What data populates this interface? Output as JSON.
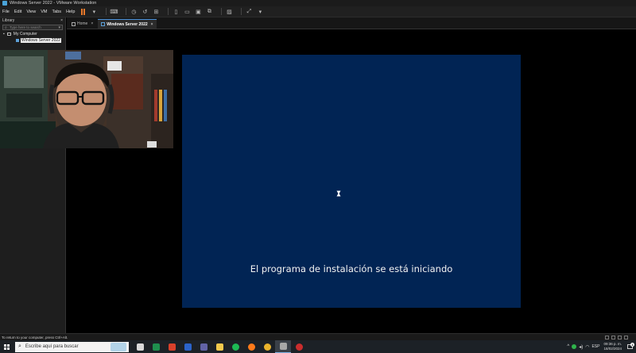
{
  "window": {
    "title": "Windows Server 2022 - VMware Workstation"
  },
  "menu": [
    "File",
    "Edit",
    "View",
    "VM",
    "Tabs",
    "Help"
  ],
  "library": {
    "header": "Library",
    "close": "×",
    "search_placeholder": "Type here to search",
    "root": "My Computer",
    "vm_item": "Windows Server 2022"
  },
  "tabs": [
    {
      "label": "Home",
      "close": "×"
    },
    {
      "label": "Windows Server 2022",
      "close": "×"
    }
  ],
  "guest": {
    "message": "El programa de instalación se está iniciando",
    "background": "#012454"
  },
  "statusbar": {
    "text": "To return to your computer, press Ctrl+Alt."
  },
  "taskbar": {
    "search_placeholder": "Escribe aquí para buscar",
    "pinned": [
      {
        "icon": "task-view-icon",
        "color": "#d9d9d9"
      },
      {
        "icon": "excel-icon",
        "color": "#1f8f4e"
      },
      {
        "icon": "fire-app-icon",
        "color": "#d9412b"
      },
      {
        "icon": "word-icon",
        "color": "#2b63c9"
      },
      {
        "icon": "teams-icon",
        "color": "#6264a7"
      },
      {
        "icon": "explorer-icon",
        "color": "#f2c94c"
      },
      {
        "icon": "spotify-icon",
        "color": "#1db954"
      },
      {
        "icon": "firefox-icon",
        "color": "#ff7a1a"
      },
      {
        "icon": "chrome-icon",
        "color": "#e9b32c"
      },
      {
        "icon": "vmware-icon",
        "color": "#a7a7a7"
      },
      {
        "icon": "record-icon",
        "color": "#c92d2d"
      }
    ],
    "lang": "ESP",
    "time": "09:36 p. m.",
    "date": "18/02/2024",
    "notifications": "1"
  }
}
